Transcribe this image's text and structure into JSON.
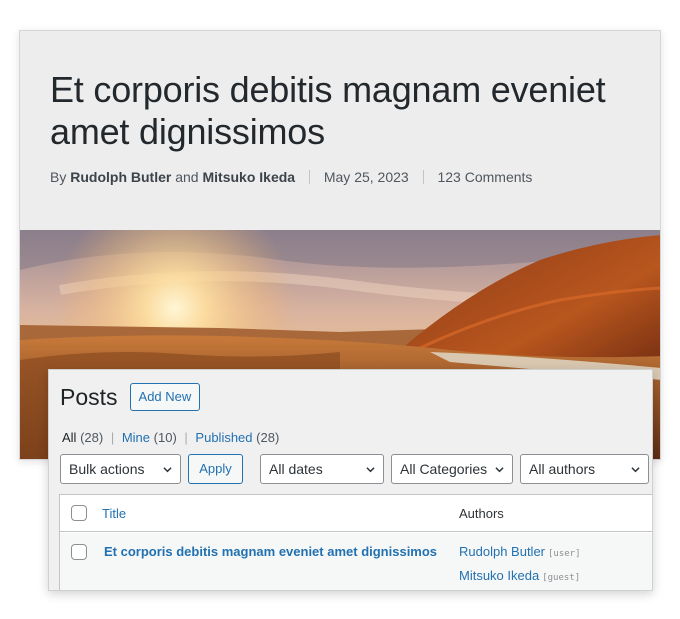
{
  "post": {
    "title": "Et corporis debitis magnam eveniet amet dignissimos",
    "by": "By",
    "author1": "Rudolph Butler",
    "and": "and",
    "author2": "Mitsuko Ikeda",
    "date": "May 25, 2023",
    "comments": "123 Comments"
  },
  "admin": {
    "page_title": "Posts",
    "add_new": "Add New",
    "views": [
      {
        "label": "All",
        "count": "(28)"
      },
      {
        "label": "Mine",
        "count": "(10)"
      },
      {
        "label": "Published",
        "count": "(28)"
      }
    ],
    "separator": "|",
    "bulk_actions": "Bulk actions",
    "apply": "Apply",
    "filters": {
      "dates": "All dates",
      "categories": "All Categories",
      "authors": "All authors"
    },
    "columns": {
      "title": "Title",
      "authors": "Authors"
    },
    "rows": [
      {
        "title": "Et corporis debitis magnam eveniet amet dignissimos",
        "authors": [
          {
            "name": "Rudolph Butler",
            "role": "[user]"
          },
          {
            "name": "Mitsuko Ikeda",
            "role": "[guest]"
          }
        ]
      }
    ]
  },
  "colors": {
    "accent": "#2271b1",
    "background": "#f0f0f1",
    "card": "#ededed"
  },
  "icons": [
    "chevron-down-icon"
  ]
}
